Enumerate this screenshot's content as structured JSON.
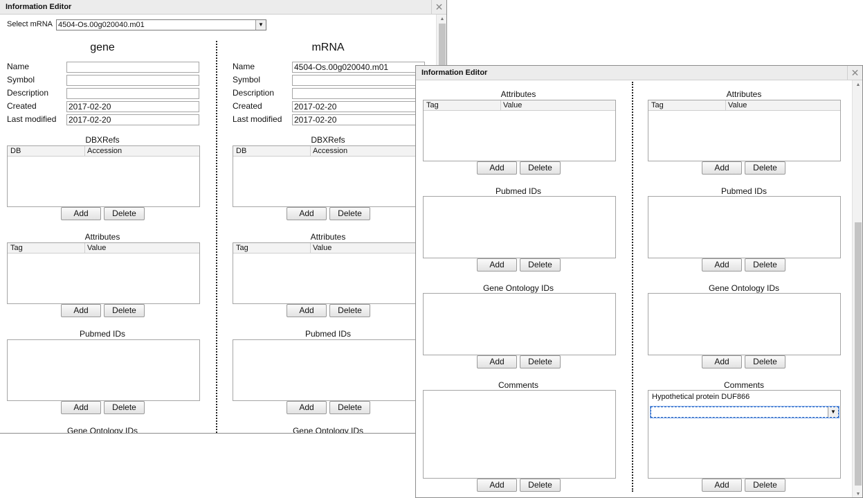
{
  "back": {
    "title": "Information Editor",
    "close": "✕",
    "select_label": "Select mRNA",
    "select_value": "4504-Os.00g020040.m01",
    "gene": {
      "heading": "gene",
      "name_label": "Name",
      "name_value": "",
      "symbol_label": "Symbol",
      "symbol_value": "",
      "description_label": "Description",
      "description_value": "",
      "created_label": "Created",
      "created_value": "2017-02-20",
      "modified_label": "Last modified",
      "modified_value": "2017-02-20",
      "dbxrefs_title": "DBXRefs",
      "db_col": "DB",
      "accession_col": "Accession",
      "attributes_title": "Attributes",
      "tag_col": "Tag",
      "value_col": "Value",
      "pubmed_title": "Pubmed IDs",
      "go_title": "Gene Ontology IDs"
    },
    "mrna": {
      "heading": "mRNA",
      "name_label": "Name",
      "name_value": "4504-Os.00g020040.m01",
      "symbol_label": "Symbol",
      "symbol_value": "",
      "description_label": "Description",
      "description_value": "",
      "created_label": "Created",
      "created_value": "2017-02-20",
      "modified_label": "Last modified",
      "modified_value": "2017-02-20",
      "dbxrefs_title": "DBXRefs",
      "db_col": "DB",
      "accession_col": "Accession",
      "attributes_title": "Attributes",
      "tag_col": "Tag",
      "value_col": "Value",
      "pubmed_title": "Pubmed IDs",
      "go_title": "Gene Ontology IDs"
    },
    "add": "Add",
    "delete": "Delete"
  },
  "front": {
    "title": "Information Editor",
    "close": "✕",
    "left": {
      "attributes_title": "Attributes",
      "tag_col": "Tag",
      "value_col": "Value",
      "pubmed_title": "Pubmed IDs",
      "go_title": "Gene Ontology IDs",
      "comments_title": "Comments"
    },
    "right": {
      "attributes_title": "Attributes",
      "tag_col": "Tag",
      "value_col": "Value",
      "pubmed_title": "Pubmed IDs",
      "go_title": "Gene Ontology IDs",
      "comments_title": "Comments",
      "comment_text": "Hypothetical protein DUF866",
      "comment_select_value": ""
    },
    "add": "Add",
    "delete": "Delete"
  }
}
